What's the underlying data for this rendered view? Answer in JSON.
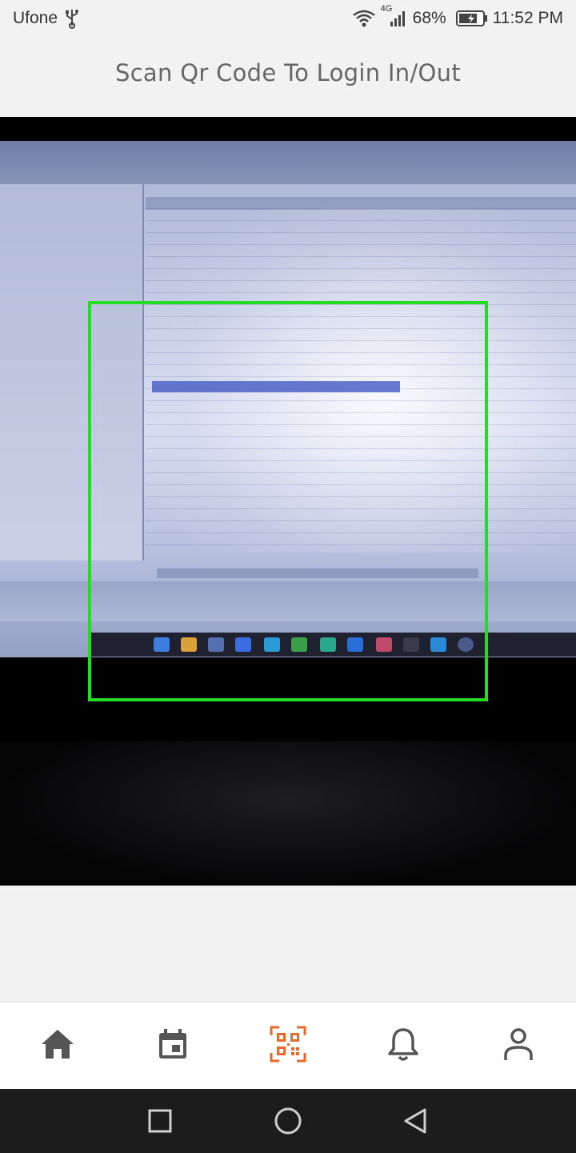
{
  "status_bar": {
    "carrier": "Ufone",
    "network": "4G",
    "battery": "68%",
    "time": "11:52 PM",
    "icons": [
      "usb-icon",
      "wifi-icon",
      "signal-icon",
      "battery-icon"
    ]
  },
  "header": {
    "title": "Scan Qr Code To Login In/Out"
  },
  "scanner": {
    "frame_color": "#22dd22"
  },
  "bottom_nav": {
    "items": [
      {
        "icon": "home-icon",
        "active": false
      },
      {
        "icon": "calendar-icon",
        "active": false
      },
      {
        "icon": "qr-scan-icon",
        "active": true
      },
      {
        "icon": "bell-icon",
        "active": false
      },
      {
        "icon": "profile-icon",
        "active": false
      }
    ],
    "active_color": "#e8692c",
    "inactive_color": "#555555"
  },
  "system_nav": {
    "icons": [
      "recents-icon",
      "home-circle-icon",
      "back-icon"
    ]
  }
}
